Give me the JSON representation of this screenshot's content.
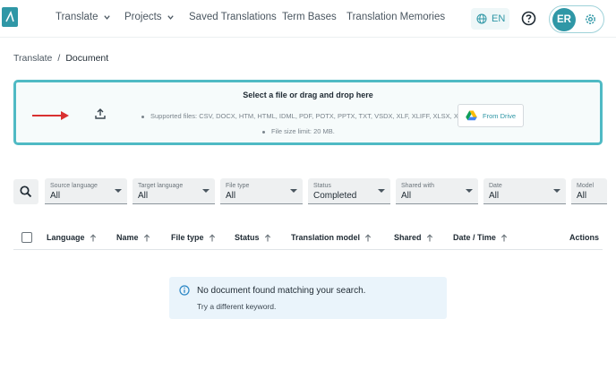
{
  "nav": {
    "items": [
      {
        "label": "Translate",
        "has_dropdown": true
      },
      {
        "label": "Projects",
        "has_dropdown": true
      },
      {
        "label": "Saved Translations",
        "has_dropdown": false
      },
      {
        "label": "Term Bases",
        "has_dropdown": false
      },
      {
        "label": "Translation Memories",
        "has_dropdown": false
      }
    ],
    "language": "EN",
    "avatar_initials": "ER",
    "accent_color": "#2f97a6"
  },
  "breadcrumb": {
    "parent": "Translate",
    "separator": "/",
    "current": "Document"
  },
  "upload": {
    "title": "Select a file or drag and drop here",
    "supported": "Supported files: CSV, DOCX, HTM, HTML, IDML, PDF, POTX, PPTX, TXT, VSDX, XLF, XLIFF, XLSX, XML",
    "size_limit": "File size limit: 20 MB.",
    "drive_button": "From Drive"
  },
  "filters": [
    {
      "label": "Source language",
      "value": "All"
    },
    {
      "label": "Target language",
      "value": "All"
    },
    {
      "label": "File type",
      "value": "All"
    },
    {
      "label": "Status",
      "value": "Completed"
    },
    {
      "label": "Shared with",
      "value": "All"
    },
    {
      "label": "Date",
      "value": "All"
    },
    {
      "label": "Model",
      "value": "All"
    }
  ],
  "table": {
    "columns": [
      "Language",
      "Name",
      "File type",
      "Status",
      "Translation model",
      "Shared",
      "Date / Time"
    ],
    "actions_label": "Actions"
  },
  "empty_state": {
    "title": "No document found matching your search.",
    "subtitle": "Try a different keyword."
  }
}
